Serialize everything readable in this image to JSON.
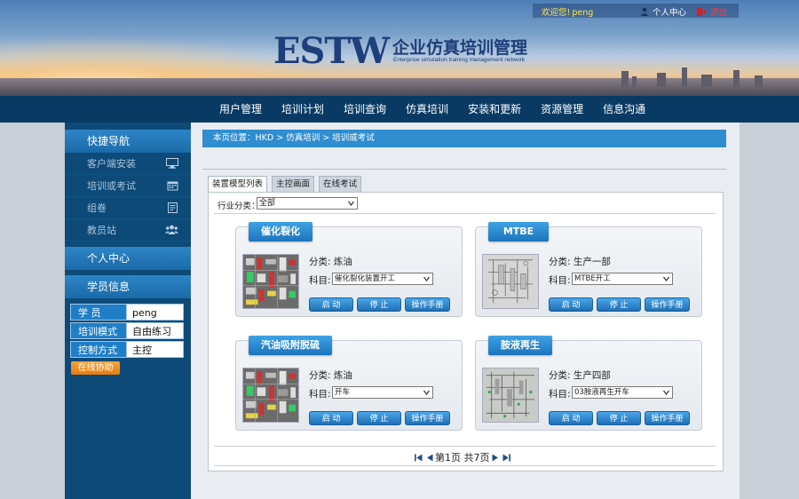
{
  "header": {
    "logo_main": "ESTW",
    "logo_cn": "企业仿真培训管理",
    "logo_sub": "Enterprise simulation training management network",
    "welcome": "欢迎您!",
    "username": "peng",
    "profile": "个人中心",
    "logout": "退出"
  },
  "nav": [
    "用户管理",
    "培训计划",
    "培训查询",
    "仿真培训",
    "安装和更新",
    "资源管理",
    "信息沟通"
  ],
  "sidebar": {
    "quick_nav_title": "快捷导航",
    "quick_items": [
      {
        "label": "客户端安装",
        "icon": "monitor-icon"
      },
      {
        "label": "培训或考试",
        "icon": "calendar-icon"
      },
      {
        "label": "组卷",
        "icon": "edit-icon"
      },
      {
        "label": "教员站",
        "icon": "users-icon"
      }
    ],
    "personal_title": "个人中心",
    "student_title": "学员信息",
    "info": [
      {
        "label": "学    员",
        "value": "peng"
      },
      {
        "label": "培训模式",
        "value": "自由练习"
      },
      {
        "label": "控制方式",
        "value": "主控"
      }
    ],
    "help_button": "在线协助"
  },
  "breadcrumb": "本页位置：HKD > 仿真培训 > 培训或考试",
  "tabs": [
    "装置模型列表",
    "主控画面",
    "在线考试"
  ],
  "filter": {
    "label": "行业分类：",
    "value": "全部"
  },
  "cards": [
    {
      "title": "催化裂化",
      "category": "分类: 炼油",
      "subject_label": "科目:",
      "subject": "催化裂化装置开工",
      "thumb": "colored"
    },
    {
      "title": "MTBE",
      "category": "分类: 生产一部",
      "subject_label": "科目:",
      "subject": "MTBE开工",
      "thumb": "gray"
    },
    {
      "title": "汽油吸附脱硫",
      "category": "分类: 炼油",
      "subject_label": "科目:",
      "subject": "开车",
      "thumb": "colored"
    },
    {
      "title": "胺液再生",
      "category": "分类: 生产四部",
      "subject_label": "科目:",
      "subject": "03胺液再生开车",
      "thumb": "gray"
    }
  ],
  "card_buttons": {
    "start": "启 动",
    "stop": "停 止",
    "manual": "操作手册"
  },
  "pager": {
    "text": "第1页 共7页"
  }
}
